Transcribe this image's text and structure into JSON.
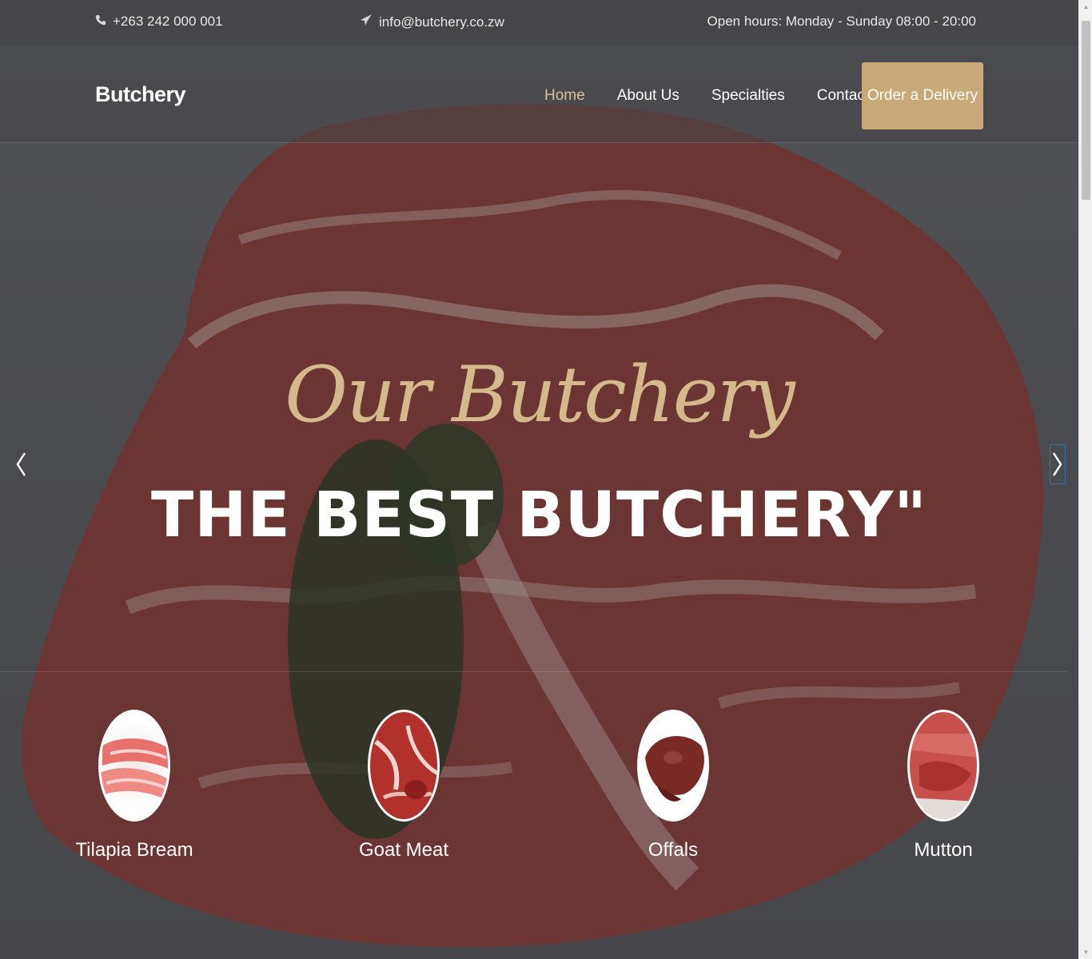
{
  "topbar": {
    "phone": "+263 242 000 001",
    "phone_icon": "phone-icon",
    "email": "info@butchery.co.zw",
    "email_icon": "paper-plane-icon",
    "hours": "Open hours: Monday - Sunday 08:00 - 20:00"
  },
  "navbar": {
    "brand": "Butchery",
    "links": [
      {
        "label": "Home",
        "active": true
      },
      {
        "label": "About Us",
        "active": false
      },
      {
        "label": "Specialties",
        "active": false
      },
      {
        "label": "Contact Us",
        "active": false
      }
    ],
    "cta": "Order a Delivery"
  },
  "hero": {
    "script_title": "Our Butchery",
    "main_title": "THE BEST BUTCHERY\"",
    "prev_icon": "chevron-left-icon",
    "next_icon": "chevron-right-icon"
  },
  "specialties": [
    {
      "label": "Tilapia Bream"
    },
    {
      "label": "Goat Meat"
    },
    {
      "label": "Offals"
    },
    {
      "label": "Mutton"
    }
  ],
  "colors": {
    "accent": "#c9a978",
    "script": "#d4b98c",
    "active_nav": "#d6c2a0"
  }
}
